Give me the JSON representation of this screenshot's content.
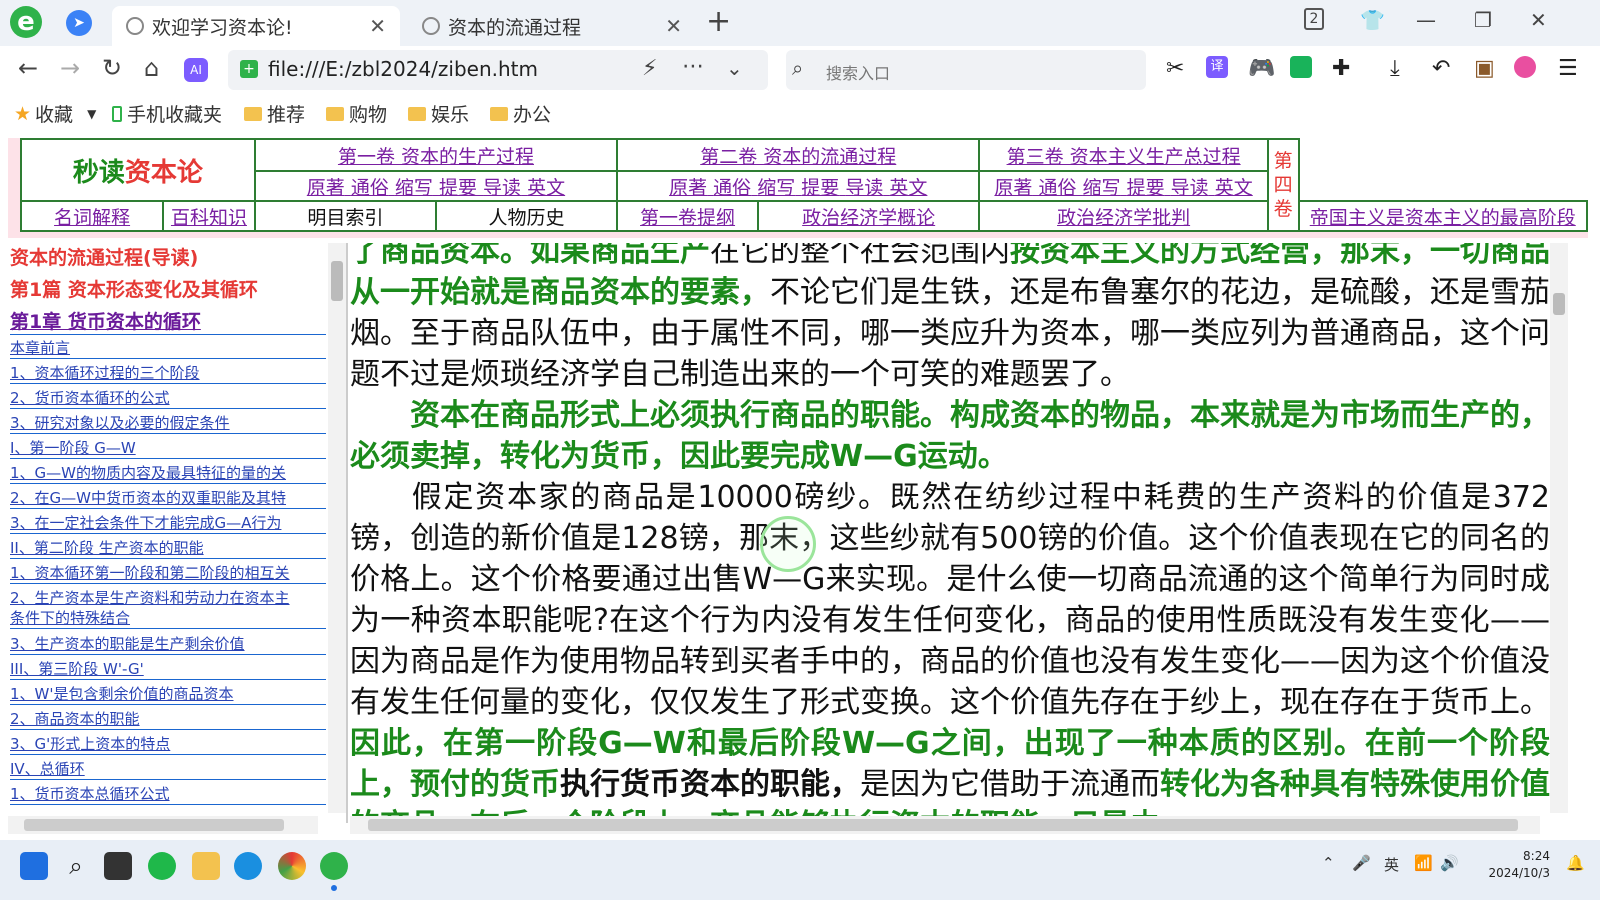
{
  "tabs": [
    {
      "label": "欢迎学习资本论!"
    },
    {
      "label": "资本的流通过程"
    }
  ],
  "url": "file:///E:/zbl2024/ziben.htm",
  "search_placeholder": "搜索入口",
  "bookmarks": {
    "star": "收藏",
    "mobile": "手机收藏夹",
    "folders": [
      "推荐",
      "购物",
      "娱乐",
      "办公"
    ]
  },
  "tab_count": "2",
  "header": {
    "brand_a": "秒读",
    "brand_b": "资本论",
    "vol1": "第一卷 资本的生产过程",
    "vol2": "第二卷 资本的流通过程",
    "vol3": "第三卷 资本主义生产总过程",
    "sub": [
      "原著",
      "通俗",
      "缩写",
      "提要",
      "导读",
      "英文"
    ],
    "vol4": "第四卷",
    "row3": [
      "名词解释",
      "百科知识",
      "明目索引",
      "人物历史",
      "第一卷提纲",
      "政治经济学概论",
      "政治经济学批判",
      "帝国主义是资本主义的最高阶段"
    ]
  },
  "sidebar": {
    "items": [
      "资本的流通过程(导读)",
      "第1篇 资本形态变化及其循环",
      "第1章 货币资本的循环",
      "本章前言",
      "1、资本循环过程的三个阶段",
      "2、货币资本循环的公式",
      "3、研究对象以及必要的假定条件",
      "I、第一阶段 G—W",
      "1、G—W的物质内容及最具特征的量的关",
      "2、在G—W中货币资本的双重职能及其特",
      "3、在一定社会条件下才能完成G—A行为",
      "II、第二阶段 生产资本的职能",
      "1、资本循环第一阶段和第二阶段的相互关",
      "2、生产资本是生产资料和劳动力在资本主",
      "条件下的特殊结合",
      "3、生产资本的职能是生产剩余价值",
      "III、第三阶段 W'-G'",
      "1、W'是包含剩余价值的商品资本",
      "2、商品资本的职能",
      "3、G'形式上资本的特点",
      "IV、总循环",
      "1、货币资本总循环公式"
    ]
  },
  "content": {
    "p1a": "了商品资本。如果商品生产",
    "p1b": "在它的整个社会范围内",
    "p1c": "按资本主义的方式经营，那末，一切商品从一开始就是商品资本的要素，",
    "p1d": "不论它们是生铁，还是布鲁塞尔的花边，是硫酸，还是雪茄烟。至于商品队伍中，由于属性不同，哪一类应升为资本，哪一类应列为普通商品，这个问题不过是烦琐经济学自己制造出来的一个可笑的难题罢了。",
    "p2": "资本在商品形式上必须执行商品的职能。构成资本的物品，本来就是为市场而生产的，必须卖掉，转化为货币，因此要完成W—G运动。",
    "p3a": "假定资本家的商品是10000磅纱。既然在纺纱过程中耗费的生产资料的价值是372镑，创造的新价值是128镑，那末，这些纱就有500镑的价值。这个价值表现在它的同名的价格上。这个价格要通过出售W—G来实现。是什么使一切商品流通的这个简单行为同时成为一种资本职能呢?在这个行为内没有发生任何变化，商品的使用性质既没有发生变化——因为商品是作为使用物品转到买者手中的，商品的价值也没有发生变化——因为这个价值没有发生任何量的变化，仅仅发生了形式变换。这个价值先存在于纱上，现在存在于货币上。",
    "p3b": "因此，在第一阶段G—W和最后阶段W—G之间，出现了一种本质的区别。在前一个阶段上，预付的货币",
    "p3c": "执行货币资本的职能，",
    "p3d": "是因为它借助于流通而",
    "p3e": "转化为各种具有特殊使用价值的商品。在后一个阶段上，商品能够执行资本的职能，只是由"
  },
  "taskbar": {
    "time": "8:24",
    "date": "2024/10/3",
    "ime": "英"
  }
}
